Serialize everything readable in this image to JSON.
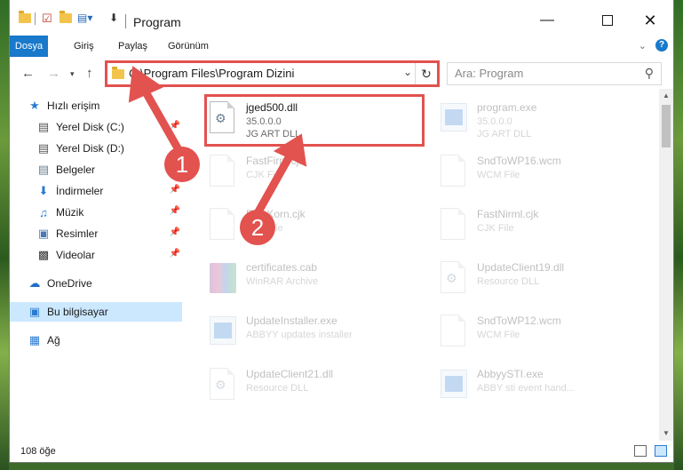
{
  "window": {
    "title": "Program",
    "accent": "#1979ca",
    "highlight_color": "#e2524f"
  },
  "ribbon": {
    "tabs": [
      "Dosya",
      "Giriş",
      "Paylaş",
      "Görünüm"
    ]
  },
  "address": {
    "path": "C:\\Program Files\\Program Dizini"
  },
  "search": {
    "placeholder": "Ara: Program"
  },
  "sidebar": {
    "items": [
      {
        "label": "Hızlı erişim",
        "icon": "star-icon"
      },
      {
        "label": "Yerel Disk (C:)",
        "icon": "drive-icon"
      },
      {
        "label": "Yerel Disk (D:)",
        "icon": "drive-icon"
      },
      {
        "label": "Belgeler",
        "icon": "documents-icon"
      },
      {
        "label": "İndirmeler",
        "icon": "download-icon"
      },
      {
        "label": "Müzik",
        "icon": "music-icon"
      },
      {
        "label": "Resimler",
        "icon": "pictures-icon"
      },
      {
        "label": "Videolar",
        "icon": "video-icon"
      },
      {
        "label": "OneDrive",
        "icon": "cloud-icon"
      },
      {
        "label": "Bu bilgisayar",
        "icon": "computer-icon"
      },
      {
        "label": "Ağ",
        "icon": "network-icon"
      }
    ]
  },
  "files": [
    {
      "name": "jged500.dll",
      "line1": "35.0.0.0",
      "line2": "JG ART DLL",
      "icon": "dll-icon"
    },
    {
      "name": "program.exe",
      "line1": "35.0.0.0",
      "line2": "JG ART DLL",
      "icon": "exe-icon"
    },
    {
      "name": "FastFirm.cjk",
      "line1": "CJK File",
      "line2": "",
      "icon": "file-icon"
    },
    {
      "name": "SndToWP16.wcm",
      "line1": "WCM File",
      "line2": "",
      "icon": "file-icon"
    },
    {
      "name": "FastKorn.cjk",
      "line1": "CJK File",
      "line2": "",
      "icon": "file-icon"
    },
    {
      "name": "FastNirml.cjk",
      "line1": "CJK File",
      "line2": "",
      "icon": "file-icon"
    },
    {
      "name": "certificates.cab",
      "line1": "WinRAR Archive",
      "line2": "",
      "icon": "archive-icon"
    },
    {
      "name": "UpdateClient19.dll",
      "line1": "Resource DLL",
      "line2": "",
      "icon": "dll-icon"
    },
    {
      "name": "UpdateInstaller.exe",
      "line1": "ABBYY updates installer",
      "line2": "",
      "icon": "exe-icon"
    },
    {
      "name": "SndToWP12.wcm",
      "line1": "WCM File",
      "line2": "",
      "icon": "file-icon"
    },
    {
      "name": "UpdateClient21.dll",
      "line1": "Resource DLL",
      "line2": "",
      "icon": "dll-icon"
    },
    {
      "name": "AbbyySTI.exe",
      "line1": "ABBY sti event hand...",
      "line2": "",
      "icon": "exe-icon"
    }
  ],
  "status": {
    "count": "108 öğe"
  },
  "annotations": {
    "step1": "1",
    "step2": "2"
  }
}
